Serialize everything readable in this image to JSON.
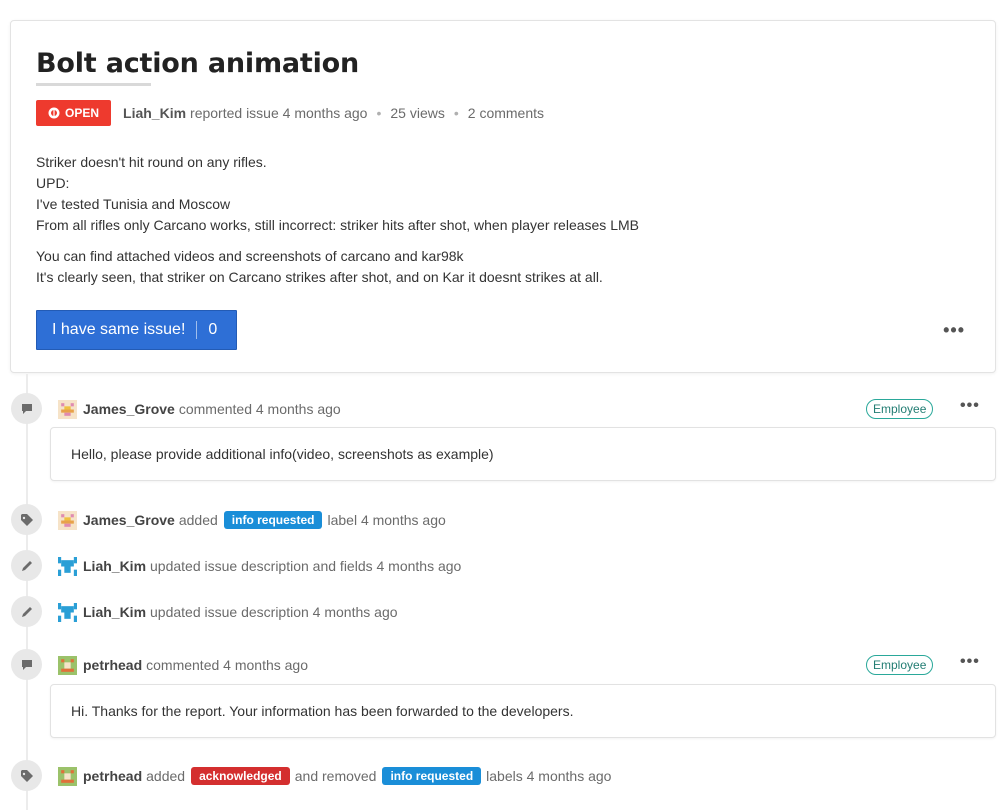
{
  "issue": {
    "title": "Bolt action animation",
    "status": "OPEN",
    "reporter": "Liah_Kim",
    "reported_text": "reported issue 4 months ago",
    "views": "25 views",
    "comments": "2 comments",
    "description": [
      "Striker doesn't hit round on any rifles.",
      "UPD:",
      "I've tested Tunisia and Moscow",
      "From all rifles only Carcano works, still incorrect: striker hits after shot, when player releases LMB"
    ],
    "description2": [
      "You can find attached videos and screenshots of carcano and kar98k",
      "It's clearly seen, that striker on Carcano strikes after shot, and on Kar it doesnt strikes at all."
    ],
    "same_issue_label": "I have same issue!",
    "same_issue_count": "0",
    "more": "•••"
  },
  "colors": {
    "open_badge": "#ee3a2e",
    "primary_button": "#2e6fd6",
    "label_info_requested": "#1a8ed8",
    "label_acknowledged": "#d42f2f",
    "employee_badge": "#2aa89a"
  },
  "timeline": {
    "e1": {
      "user": "James_Grove",
      "text": "commented 4 months ago",
      "badge": "Employee",
      "more": "•••",
      "comment": "Hello, please provide additional info(video, screenshots as example)"
    },
    "e2": {
      "user": "James_Grove",
      "text1": "added",
      "label": "info requested",
      "text2": "label 4 months ago"
    },
    "e3": {
      "user": "Liah_Kim",
      "text": "updated issue description and fields 4 months ago"
    },
    "e4": {
      "user": "Liah_Kim",
      "text": "updated issue description 4 months ago"
    },
    "e5": {
      "user": "petrhead",
      "text": "commented 4 months ago",
      "badge": "Employee",
      "more": "•••",
      "comment": "Hi. Thanks for the report. Your information has been forwarded to the developers."
    },
    "e6": {
      "user": "petrhead",
      "text1": "added",
      "label1": "acknowledged",
      "text2": "and removed",
      "label2": "info requested",
      "text3": "labels 4 months ago"
    }
  }
}
